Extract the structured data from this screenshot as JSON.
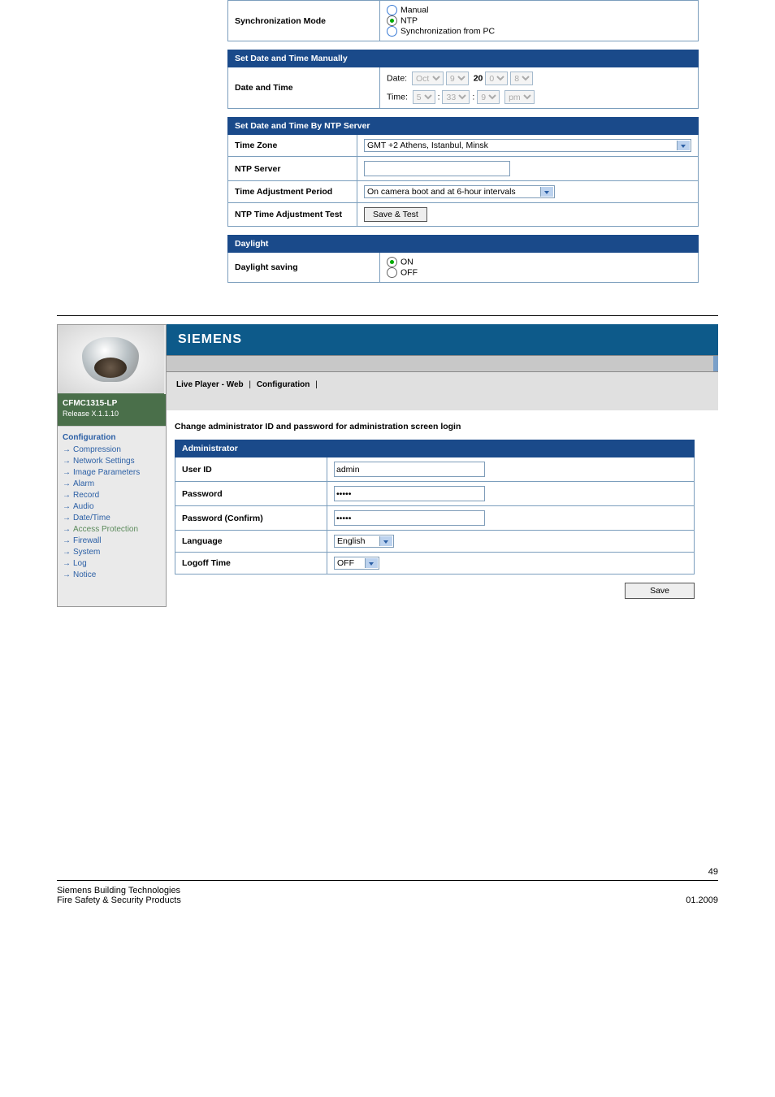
{
  "top": {
    "sync_mode_label": "Synchronization Mode",
    "sync_opts": {
      "manual": "Manual",
      "ntp": "NTP",
      "pc": "Synchronization from PC"
    },
    "section_manual": "Set Date and Time Manually",
    "datetime_label": "Date and Time",
    "date_prefix": "Date:",
    "date_mon": "Oct",
    "date_d1": "9",
    "date_y1": "20",
    "date_y2": "0",
    "date_y3": "8",
    "time_prefix": "Time:",
    "time_h": "5",
    "time_m": "33",
    "time_s": "9",
    "time_ampm": "pm",
    "colon": ":",
    "section_ntp": "Set Date and Time By NTP Server",
    "tz_label": "Time Zone",
    "tz_value": "GMT +2 Athens, Istanbul, Minsk",
    "ntp_server_label": "NTP Server",
    "ntp_server_value": "",
    "adj_period_label": "Time Adjustment Period",
    "adj_period_value": "On camera boot and at 6-hour intervals",
    "ntp_test_label": "NTP Time Adjustment Test",
    "save_test_btn": "Save & Test",
    "section_daylight": "Daylight",
    "daylight_label": "Daylight saving",
    "on": "ON",
    "off": "OFF"
  },
  "ss": {
    "brand": "SIEMENS",
    "model": "CFMC1315-LP",
    "release": "Release X.1.1.10",
    "menu_hd": "Configuration",
    "menu": [
      "Compression",
      "Network Settings",
      "Image Parameters",
      "Alarm",
      "Record",
      "Audio",
      "Date/Time",
      "Access Protection",
      "Firewall",
      "System",
      "Log",
      "Notice"
    ],
    "menu_selected": "Access Protection",
    "nav_live": "Live Player - Web",
    "nav_conf": "Configuration",
    "admin_title": "Change administrator ID and password for administration screen login",
    "tbl_header": "Administrator",
    "user_id_label": "User ID",
    "user_id_value": "admin",
    "pw_label": "Password",
    "pw_value": "•••••",
    "pwc_label": "Password (Confirm)",
    "pwc_value": "•••••",
    "lang_label": "Language",
    "lang_value": "English",
    "logoff_label": "Logoff Time",
    "logoff_value": "OFF",
    "save_btn": "Save"
  },
  "footer": {
    "page": "49",
    "l1": "Siemens Building Technologies",
    "l2": "Fire Safety & Security Products",
    "date": "01.2009"
  }
}
